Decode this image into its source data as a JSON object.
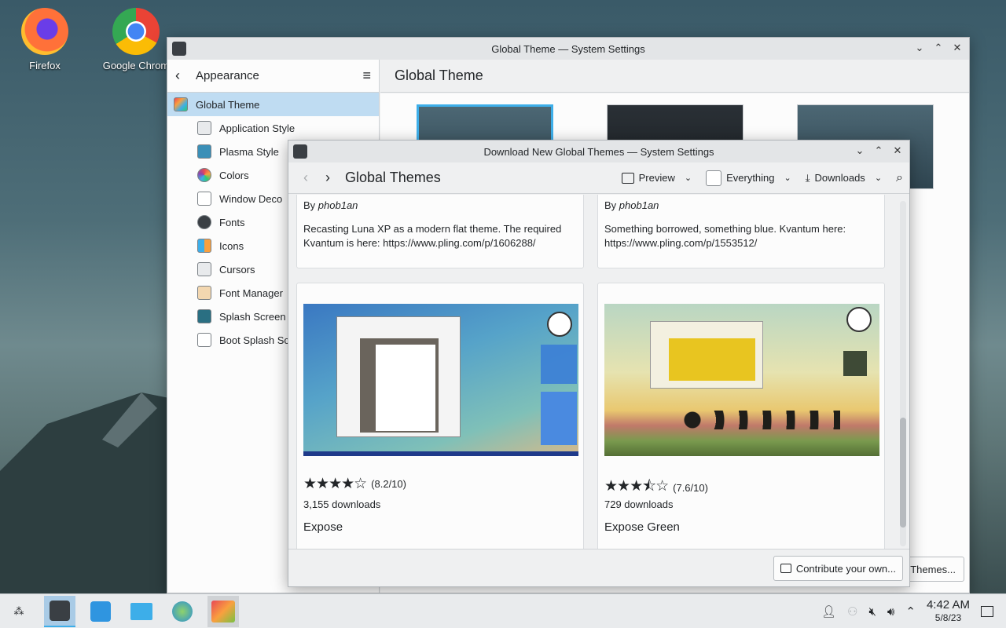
{
  "desktop": {
    "icons": [
      {
        "label": "Firefox",
        "icon": "firefox-icon"
      },
      {
        "label": "Google Chrom",
        "icon": "chrome-icon"
      }
    ]
  },
  "main_window": {
    "title": "Global Theme — System Settings",
    "sidebar": {
      "header": "Appearance",
      "items": [
        {
          "label": "Global Theme",
          "selected": true
        },
        {
          "label": "Application Style"
        },
        {
          "label": "Plasma Style"
        },
        {
          "label": "Colors"
        },
        {
          "label": "Window Deco"
        },
        {
          "label": "Fonts"
        },
        {
          "label": "Icons"
        },
        {
          "label": "Cursors"
        },
        {
          "label": "Font Manager"
        },
        {
          "label": "Splash Screen"
        },
        {
          "label": "Boot Splash Sc"
        }
      ]
    },
    "heading": "Global Theme",
    "themes_button": "Themes..."
  },
  "dialog": {
    "title": "Download New Global Themes — System Settings",
    "toolbar": {
      "title": "Global Themes",
      "view_mode": "Preview",
      "filter": "Everything",
      "sort": "Downloads"
    },
    "cards_top": [
      {
        "by_prefix": "By",
        "author": "phob1an",
        "description": "Recasting Luna XP as a modern flat theme. The required Kvantum is here: https://www.pling.com/p/1606288/"
      },
      {
        "by_prefix": "By",
        "author": "phob1an",
        "description": "Something borrowed, something blue. Kvantum here: https://www.pling.com/p/1553512/"
      }
    ],
    "cards": [
      {
        "name": "Expose",
        "rating": "(8.2/10)",
        "rating_value": 8.2,
        "downloads": "3,155 downloads"
      },
      {
        "name": "Expose Green",
        "rating": "(7.6/10)",
        "rating_value": 7.6,
        "downloads": "729 downloads"
      }
    ],
    "contribute_button": "Contribute your own..."
  },
  "taskbar": {
    "time": "4:42 AM",
    "date": "5/8/23"
  },
  "colors": {
    "accent": "#3daee9",
    "selection": "#bfdcf2"
  }
}
